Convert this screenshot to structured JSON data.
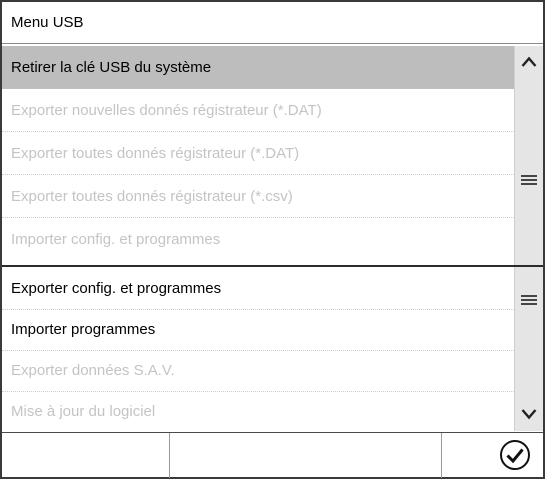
{
  "title": "Menu USB",
  "items": [
    {
      "label": "Retirer la clé USB du système",
      "state": "selected"
    },
    {
      "label": "Exporter nouvelles donnés régistrateur (*.DAT)",
      "state": "disabled"
    },
    {
      "label": "Exporter toutes donnés régistrateur (*.DAT)",
      "state": "disabled"
    },
    {
      "label": "Exporter toutes donnés régistrateur (*.csv)",
      "state": "disabled"
    },
    {
      "label": "Importer config. et programmes",
      "state": "disabled"
    },
    {
      "label": "Exporter config. et programmes",
      "state": "enabled"
    },
    {
      "label": "Importer programmes",
      "state": "enabled"
    },
    {
      "label": "Exporter données S.A.V.",
      "state": "disabled"
    },
    {
      "label": "Mise à jour du logiciel",
      "state": "disabled"
    }
  ],
  "icons": {
    "scroll_up": "chevron-up-icon",
    "page_top": "menu-lines-icon",
    "page_bottom": "menu-lines-icon",
    "scroll_down": "chevron-down-icon",
    "confirm": "check-circle-icon"
  },
  "colors": {
    "selected_background": "#bdbdbd",
    "disabled_text": "#c4c4c4",
    "scrollbar": "#e5e5e5"
  }
}
